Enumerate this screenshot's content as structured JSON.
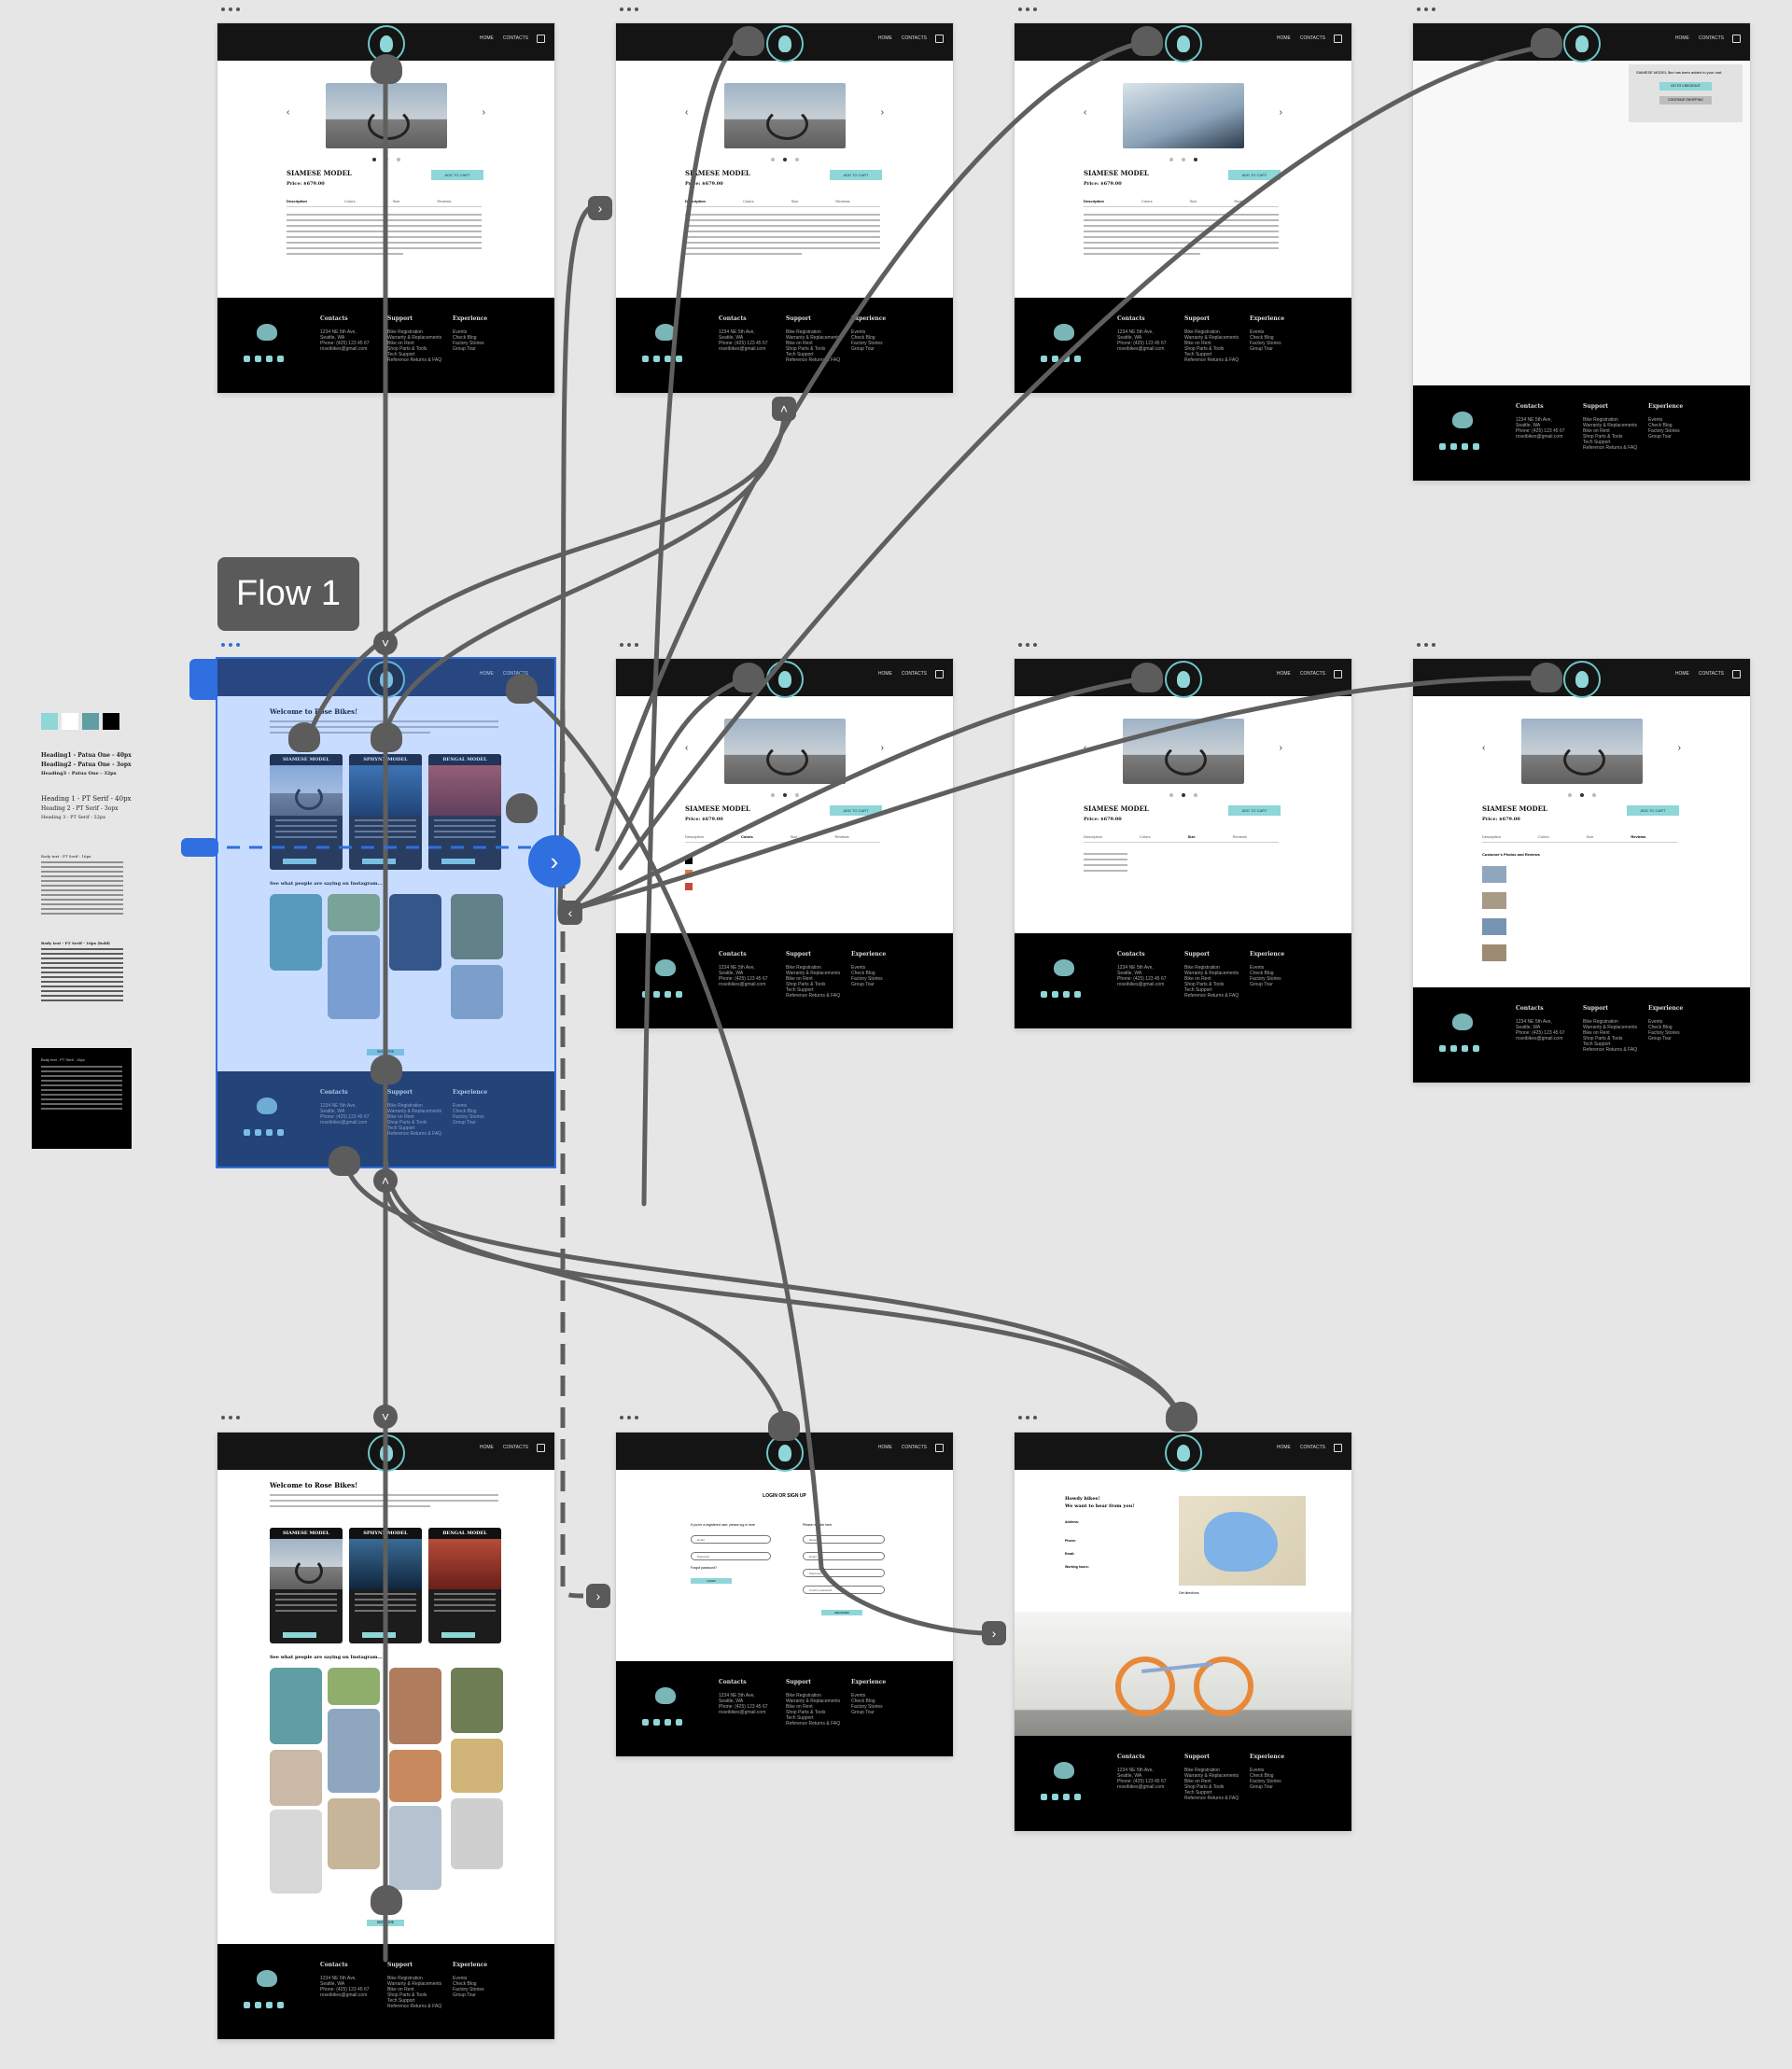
{
  "flow": {
    "label": "Flow 1"
  },
  "common": {
    "nav": [
      "HOME",
      "CONTACTS"
    ],
    "footer": {
      "contacts_title": "Contacts",
      "support_title": "Support",
      "experience_title": "Experience",
      "contacts_lines": [
        "1234 NE 5th Ave,",
        "Seattle, WA",
        "Phone: (425) 123 45 67",
        "roseibikes@gmail.com"
      ],
      "support_lines": [
        "Bike Registration",
        "Warranty & Replacements",
        "Bike on Rent",
        "Shop Parts & Tools",
        "Tech Support",
        "Reference Returns & FAQ"
      ],
      "experience_lines": [
        "Events",
        "Check Blog",
        "Factory Stories",
        "Group Tour"
      ]
    }
  },
  "product": {
    "title": "SIAMESE MODEL",
    "price": "Price: $679.00",
    "add_to_cart": "ADD TO CART",
    "tabs": [
      "Description",
      "Colors",
      "Size",
      "Reviews"
    ]
  },
  "home": {
    "welcome": "Welcome to Rose Bikes!",
    "cards": [
      "SIAMESE MODEL",
      "SPHYNX MODEL",
      "BENGAL MODEL"
    ],
    "card_button": "READ MORE",
    "insta_heading": "See what people are saying on Instagram...",
    "see_more": "SEE MORE"
  },
  "reviews_heading": "Customer's Photos and Reviews",
  "cart_popup": {
    "text": "SIAMESE MODEL $xx has been added to your cart.",
    "btn_checkout": "GO TO CHECKOUT",
    "btn_continue": "CONTINUE SHOPPING"
  },
  "login": {
    "title": "LOGIN OR SIGN UP",
    "left_label": "If you're a registered user, please log in here",
    "right_label": "Please register here",
    "login_btn": "LOGIN",
    "register_btn": "REGISTER",
    "forgot": "Forgot password?",
    "fields_left": [
      "Email",
      "Password"
    ],
    "fields_right": [
      "Name",
      "Email",
      "Password",
      "Confirm password"
    ]
  },
  "contact": {
    "heading1": "Howdy bikes!",
    "heading2": "We want to hear from you!",
    "address_label": "Address:",
    "phone_label": "Phone:",
    "email_label": "Email:",
    "hours_label": "Working hours:",
    "directions": "Get directions"
  },
  "styleguide": {
    "h1": "Heading1 - Patua One - 40px",
    "h2": "Heading2 - Patua One - 3opx",
    "h3": "Heading3 - Patua One - 32px",
    "pt1": "Heading 1 - PT Serif - 40px",
    "pt2": "Heading 2 - PT Serif - 3opx",
    "pt3": "Heading 3 - PT Serif - 32px",
    "body1": "Body text - PT Serif - 16px",
    "body2": "Body text - PT Serif - 16px (bold)",
    "body3": "Body text - PT Serif - 16px",
    "colors": [
      "#8fd6d8",
      "#ffffff",
      "#5f9fa3",
      "#222222",
      "#000000"
    ]
  }
}
